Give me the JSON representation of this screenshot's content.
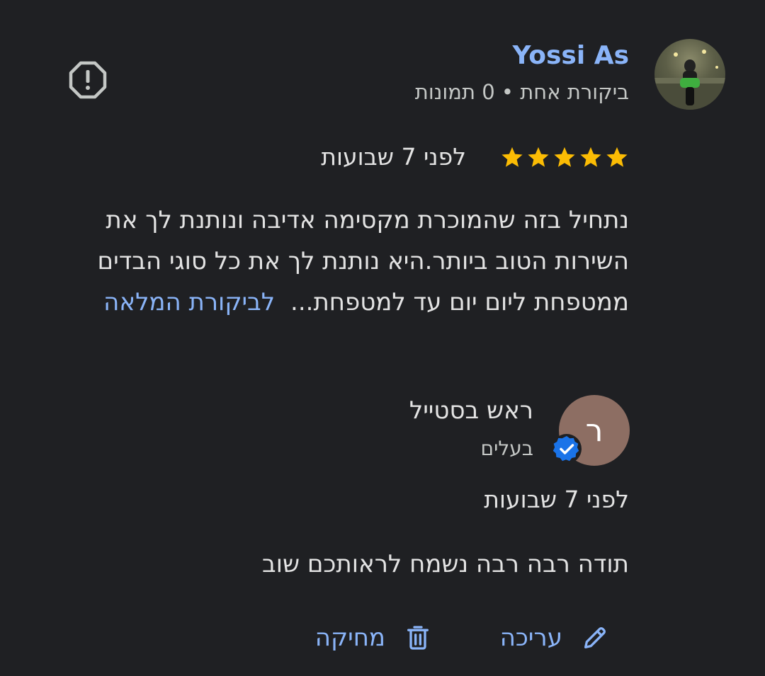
{
  "reviewer": {
    "name": "Yossi As",
    "stats": "ביקורת אחת • 0 תמונות",
    "rating": 5,
    "rating_max": 5,
    "time": "לפני 7 שבועות",
    "text": "נתחיל בזה שהמוכרת מקסימה אדיבה ונותנת לך את השירות הטוב ביותר.היא נותנת לך את כל סוגי הבדים ממטפחת ליום יום עד למטפחת...",
    "full_review_link": "לביקורת המלאה"
  },
  "owner_reply": {
    "avatar_letter": "ר",
    "name": "ראש בסטייל",
    "role": "בעלים",
    "time": "לפני 7 שבועות",
    "text": "תודה רבה רבה נשמח לראותכם שוב"
  },
  "actions": {
    "edit_label": "עריכה",
    "delete_label": "מחיקה"
  },
  "colors": {
    "background": "#1f2023",
    "link": "#8ab4f8",
    "star": "#fbbc04",
    "verified": "#1a73e8",
    "owner_avatar": "#8d6e63"
  },
  "icons": {
    "report": "report-icon",
    "star": "star-icon",
    "verified": "verified-check-icon",
    "edit": "pencil-icon",
    "delete": "trash-icon"
  }
}
